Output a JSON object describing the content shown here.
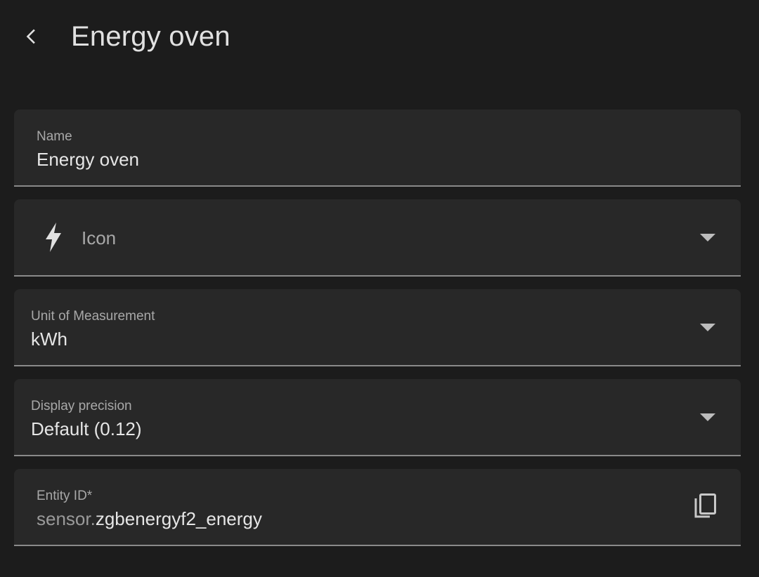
{
  "header": {
    "title": "Energy oven",
    "back_icon": "chevron-left-icon"
  },
  "form": {
    "name": {
      "label": "Name",
      "value": "Energy oven"
    },
    "icon": {
      "label": "Icon",
      "icon": "lightning-bolt-icon"
    },
    "unit": {
      "label": "Unit of Measurement",
      "value": "kWh"
    },
    "precision": {
      "label": "Display precision",
      "value": "Default (0.12)"
    },
    "entity_id": {
      "label": "Entity ID*",
      "prefix": "sensor.",
      "value": "zgbenergyf2_energy",
      "copy_icon": "copy-icon"
    }
  },
  "colors": {
    "background": "#1c1c1c",
    "field_background": "#282828",
    "field_underline": "#8a8a8a",
    "text_primary": "#e6e6e6",
    "text_secondary": "#a8a8a8"
  }
}
